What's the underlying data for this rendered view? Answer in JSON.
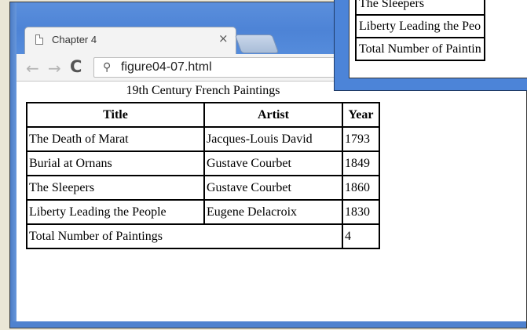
{
  "browser": {
    "tab_title": "Chapter 4",
    "tab_close_glyph": "×",
    "url": "figure04-07.html",
    "back_glyph": "←",
    "forward_glyph": "→",
    "reload_glyph": "C",
    "search_glyph": "⚲"
  },
  "table": {
    "caption": "19th Century French Paintings",
    "headers": [
      "Title",
      "Artist",
      "Year"
    ],
    "rows": [
      [
        "The Death of Marat",
        "Jacques-Louis David",
        "1793"
      ],
      [
        "Burial at Ornans",
        "Gustave Courbet",
        "1849"
      ],
      [
        "The Sleepers",
        "Gustave Courbet",
        "1860"
      ],
      [
        "Liberty Leading the People",
        "Eugene Delacroix",
        "1830"
      ]
    ],
    "footer": [
      "Total Number of Paintings",
      "4"
    ]
  },
  "back_window": {
    "rows": [
      "The Sleepers",
      "Liberty Leading the Peo",
      "Total Number of Paintin"
    ]
  }
}
